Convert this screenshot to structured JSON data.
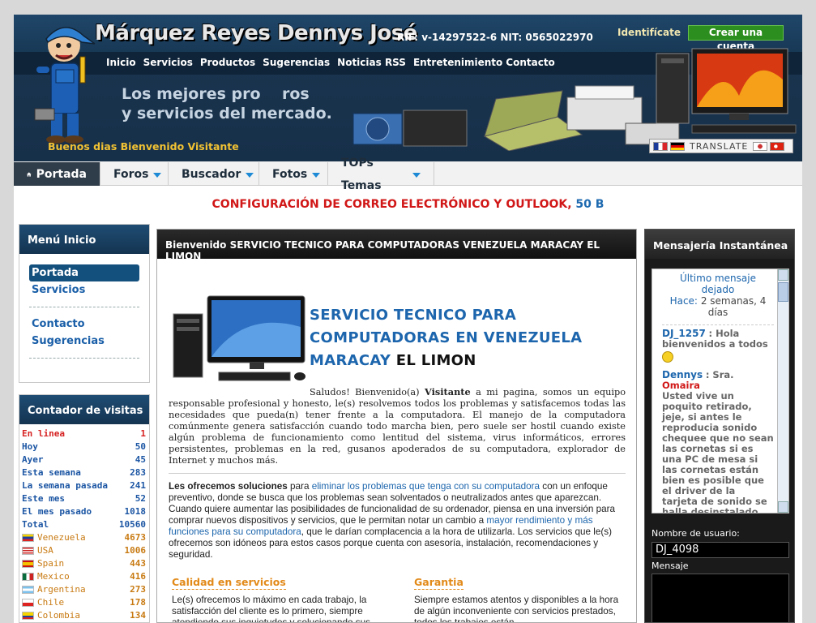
{
  "header": {
    "brand": "Márquez Reyes Dennys José",
    "rif": "RIF: v-14297522-6  NIT: 0565022970",
    "login_link": "Identifícate",
    "signup_button": "Crear una cuenta",
    "nav": [
      "Inicio",
      "Servicios",
      "Productos",
      "Sugerencias",
      "Noticias RSS",
      "Entretenimiento",
      "Contacto"
    ],
    "slogan_line1": "Los mejores pro    ros",
    "slogan_line2": "y servicios del mercado.",
    "greeting": "Buenos dias Bienvenido Visitante",
    "translate_label": "TRANSLATE"
  },
  "tabs": [
    {
      "label": "Portada",
      "active": true
    },
    {
      "label": "Foros"
    },
    {
      "label": "Buscador"
    },
    {
      "label": "Fotos"
    },
    {
      "label": "TOPs Temas"
    }
  ],
  "ticker": {
    "text": "CONFIGURACIÓN DE CORREO ELECTRÓNICO Y OUTLOOK,",
    "size": "50 B"
  },
  "left_menu": {
    "title": "Menú Inicio",
    "items": [
      "Portada",
      "Servicios",
      "Contacto",
      "Sugerencias"
    ]
  },
  "counter": {
    "title": "Contador de visitas",
    "rows": [
      {
        "label": "En linea",
        "value": "1"
      },
      {
        "label": "Hoy",
        "value": "50"
      },
      {
        "label": "Ayer",
        "value": "45"
      },
      {
        "label": "Esta semana",
        "value": "283"
      },
      {
        "label": "La semana pasada",
        "value": "241"
      },
      {
        "label": "Este mes",
        "value": "52"
      },
      {
        "label": "El mes pasado",
        "value": "1018"
      },
      {
        "label": "Total",
        "value": "10560"
      }
    ],
    "countries": [
      {
        "label": "Venezuela",
        "value": "4673"
      },
      {
        "label": "USA",
        "value": "1006"
      },
      {
        "label": "Spain",
        "value": "443"
      },
      {
        "label": "Mexico",
        "value": "416"
      },
      {
        "label": "Argentina",
        "value": "273"
      },
      {
        "label": "Chile",
        "value": "178"
      },
      {
        "label": "Colombia",
        "value": "134"
      }
    ]
  },
  "center": {
    "header": "Bienvenido SERVICIO TECNICO PARA COMPUTADORAS VENEZUELA MARACAY EL LIMON",
    "title_line1": "SERVICIO TECNICO PARA",
    "title_line2": "COMPUTADORAS EN VENEZUELA",
    "title_line3": "MARACAY",
    "title_bold": "EL LIMON",
    "p1_a": "Saludos! Bienvenido(a)",
    "p1_visitor": "Visitante",
    "p1_b": "a mi pagina, somos un equipo responsable profesional y honesto, le(s) resolvemos todos los problemas y satisfacemos todas las necesidades que pueda(n) tener frente a la computadora. El manejo de la computadora comúnmente genera satisfacción cuando todo marcha bien, pero suele ser hostil cuando existe algún problema de funcionamiento como lentitud del sistema, virus informáticos, errores persistentes, problemas en la red, gusanos apoderados de su computadora, explorador de Internet y muchos más.",
    "p2_bold": "Les ofrecemos soluciones",
    "p2_a": "para",
    "p2_link1": "eliminar los problemas que tenga con su computadora",
    "p2_b": "con un enfoque preventivo, donde se busca que los problemas sean solventados o neutralizados antes que aparezcan. Cuando quiere aumentar las posibilidades de funcionalidad de su ordenador, piensa en una inversión para comprar nuevos dispositivos y servicios, que le permitan notar un cambio a",
    "p2_link2": "mayor rendimiento y más funciones para su computadora",
    "p2_c": ", que le darían complacencia a la hora de utilizarla. Los servicios que le(s) ofrecemos son idóneos para estos casos porque cuenta con asesoría, instalación, recomendaciones y seguridad.",
    "col1_title": "Calidad en servicios",
    "col1_text": "Le(s) ofrecemos lo máximo en cada trabajo, la satisfacción del cliente es lo primero, siempre atendiendo sus inquietudes y solucionando sus",
    "col2_title": "Garantia",
    "col2_text": "Siempre estamos atentos y disponibles a la hora de algún inconveniente con servicios prestados, todos los trabajos están"
  },
  "chat": {
    "title": "Mensajería Instantánea",
    "last_label": "Último mensaje dejado",
    "last_ago_label": "Hace:",
    "last_ago": "2 semanas, 4 días",
    "msg1_user": "DJ_1257",
    "msg1_text": ": Hola bienvenidos a todos",
    "msg2_user": "Dennys",
    "msg2_prefix": ": Sra.",
    "msg2_name": "Omaira",
    "msg2_text": "Usted vive un poquito retirado, jeje, si antes le reproducia sonido chequee que no sean las cornetas si es una PC de mesa si las cornetas están bien es posible que el driver de la tarjeta de sonido se halla desinstalado por virus o que lo hallan desinstalado, si es una tarjeta externa y no la integrada",
    "username_label": "Nombre de usuario:",
    "username_value": "DJ_4098",
    "message_label": "Mensaje"
  },
  "colors": {
    "accent": "#1d66ad",
    "alert": "#d11717",
    "gold": "#f2c233",
    "orange": "#e28a1a"
  }
}
